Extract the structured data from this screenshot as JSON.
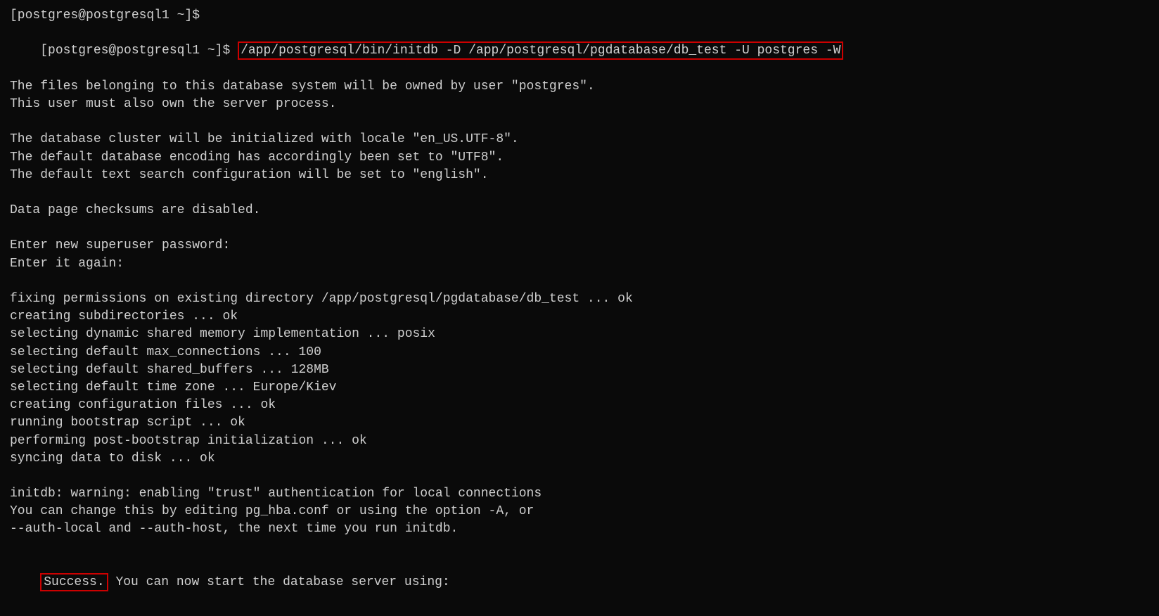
{
  "terminal": {
    "lines": [
      {
        "id": "line1",
        "type": "plain",
        "text": "[postgres@postgresql1 ~]$"
      },
      {
        "id": "line2",
        "type": "command",
        "prompt": "[postgres@postgresql1 ~]$ ",
        "command": "/app/postgresql/bin/initdb -D /app/postgresql/pgdatabase/db_test -U postgres -W"
      },
      {
        "id": "line3",
        "type": "plain",
        "text": "The files belonging to this database system will be owned by user \"postgres\"."
      },
      {
        "id": "line4",
        "type": "plain",
        "text": "This user must also own the server process."
      },
      {
        "id": "line5",
        "type": "empty"
      },
      {
        "id": "line6",
        "type": "plain",
        "text": "The database cluster will be initialized with locale \"en_US.UTF-8\"."
      },
      {
        "id": "line7",
        "type": "plain",
        "text": "The default database encoding has accordingly been set to \"UTF8\"."
      },
      {
        "id": "line8",
        "type": "plain",
        "text": "The default text search configuration will be set to \"english\"."
      },
      {
        "id": "line9",
        "type": "empty"
      },
      {
        "id": "line10",
        "type": "plain",
        "text": "Data page checksums are disabled."
      },
      {
        "id": "line11",
        "type": "empty"
      },
      {
        "id": "line12",
        "type": "plain",
        "text": "Enter new superuser password:"
      },
      {
        "id": "line13",
        "type": "plain",
        "text": "Enter it again:"
      },
      {
        "id": "line14",
        "type": "empty"
      },
      {
        "id": "line15",
        "type": "plain",
        "text": "fixing permissions on existing directory /app/postgresql/pgdatabase/db_test ... ok"
      },
      {
        "id": "line16",
        "type": "plain",
        "text": "creating subdirectories ... ok"
      },
      {
        "id": "line17",
        "type": "plain",
        "text": "selecting dynamic shared memory implementation ... posix"
      },
      {
        "id": "line18",
        "type": "plain",
        "text": "selecting default max_connections ... 100"
      },
      {
        "id": "line19",
        "type": "plain",
        "text": "selecting default shared_buffers ... 128MB"
      },
      {
        "id": "line20",
        "type": "plain",
        "text": "selecting default time zone ... Europe/Kiev"
      },
      {
        "id": "line21",
        "type": "plain",
        "text": "creating configuration files ... ok"
      },
      {
        "id": "line22",
        "type": "plain",
        "text": "running bootstrap script ... ok"
      },
      {
        "id": "line23",
        "type": "plain",
        "text": "performing post-bootstrap initialization ... ok"
      },
      {
        "id": "line24",
        "type": "plain",
        "text": "syncing data to disk ... ok"
      },
      {
        "id": "line25",
        "type": "empty"
      },
      {
        "id": "line26",
        "type": "plain",
        "text": "initdb: warning: enabling \"trust\" authentication for local connections"
      },
      {
        "id": "line27",
        "type": "plain",
        "text": "You can change this by editing pg_hba.conf or using the option -A, or"
      },
      {
        "id": "line28",
        "type": "plain",
        "text": "--auth-local and --auth-host, the next time you run initdb."
      },
      {
        "id": "line29",
        "type": "empty"
      },
      {
        "id": "line30",
        "type": "success",
        "success_word": "Success.",
        "rest": " You can now start the database server using:"
      }
    ]
  }
}
